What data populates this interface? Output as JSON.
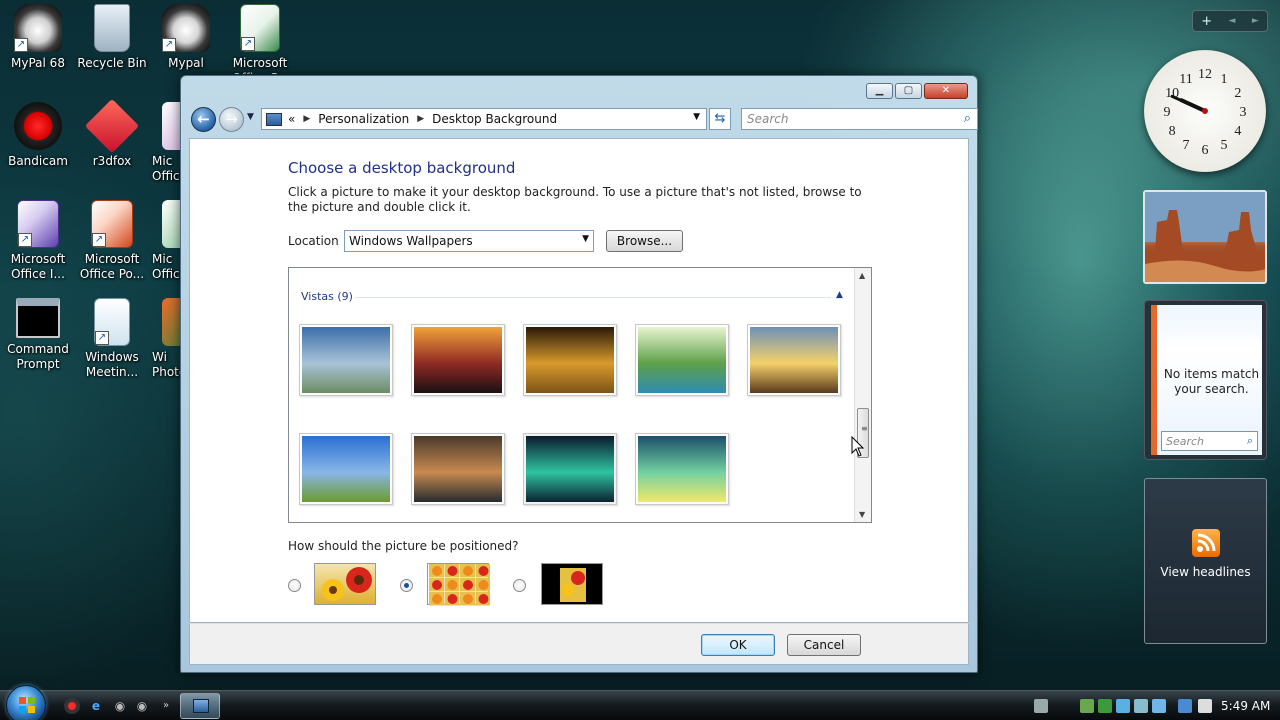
{
  "desktop": {
    "icons": [
      {
        "label": "MyPal 68"
      },
      {
        "label": "Recycle Bin"
      },
      {
        "label": "Mypal"
      },
      {
        "label": "Microsoft Office P..."
      },
      {
        "label": "Bandicam"
      },
      {
        "label": "r3dfox"
      },
      {
        "label": "Mic Offic"
      },
      {
        "label": "Microsoft Office I..."
      },
      {
        "label": "Microsoft Office Po..."
      },
      {
        "label": "Mic Offic"
      },
      {
        "label": "Command Prompt"
      },
      {
        "label": "Windows Meetin..."
      },
      {
        "label": "Wi Photo"
      }
    ]
  },
  "gadgets": {
    "toolbar": {
      "add": "+",
      "prev": "◄",
      "next": "►"
    },
    "clock": {
      "hour": 9,
      "minute": 49,
      "numerals": [
        "12",
        "1",
        "2",
        "3",
        "4",
        "5",
        "6",
        "7",
        "8",
        "9",
        "10",
        "11"
      ]
    },
    "feed_search": {
      "message": "No items match your search.",
      "search_placeholder": "Search"
    },
    "headlines": {
      "label": "View headlines"
    }
  },
  "window": {
    "controls": {
      "minimize": "▁",
      "maximize": "▢",
      "close": "✕"
    },
    "breadcrumb": [
      "Personalization",
      "Desktop Background"
    ],
    "breadcrumb_prefix": "«",
    "search_placeholder": "Search",
    "heading": "Choose a desktop background",
    "description": "Click a picture to make it your desktop background. To use a picture that's not listed, browse to the picture and double click it.",
    "location_label": "Location",
    "location_value": "Windows Wallpapers",
    "browse_label": "Browse...",
    "group_label": "Vistas (9)",
    "wallpapers": [
      {
        "name": "river-valley",
        "colors": [
          "#3c6ea8",
          "#a9c3d8",
          "#6c8c63"
        ]
      },
      {
        "name": "sunset-silhouette",
        "colors": [
          "#f1a23a",
          "#8f2a24",
          "#1c1012"
        ]
      },
      {
        "name": "rocky-shore",
        "colors": [
          "#2a1a0a",
          "#d89a2c",
          "#7c5318"
        ]
      },
      {
        "name": "palm-leaf",
        "colors": [
          "#e8f4d0",
          "#5ea14a",
          "#2f8cb0"
        ]
      },
      {
        "name": "field-sunrise",
        "colors": [
          "#6e90b8",
          "#f4d16a",
          "#5b3a1c"
        ]
      },
      {
        "name": "green-hills",
        "colors": [
          "#2a6fd2",
          "#88b6e8",
          "#6d9b2c"
        ]
      },
      {
        "name": "mountain-lake",
        "colors": [
          "#4a3a2c",
          "#c88a50",
          "#262a30"
        ]
      },
      {
        "name": "aurora",
        "colors": [
          "#0a1a2c",
          "#2fc3a0",
          "#0c2230"
        ]
      },
      {
        "name": "aero-glow",
        "colors": [
          "#1c4f6c",
          "#72d0a0",
          "#f0e86a"
        ]
      }
    ],
    "position_label": "How should the picture be positioned?",
    "position_options": [
      {
        "name": "fit-to-screen",
        "selected": false
      },
      {
        "name": "tile",
        "selected": true
      },
      {
        "name": "center",
        "selected": false
      }
    ],
    "ok_label": "OK",
    "cancel_label": "Cancel"
  },
  "taskbar": {
    "time": "5:49 AM"
  }
}
